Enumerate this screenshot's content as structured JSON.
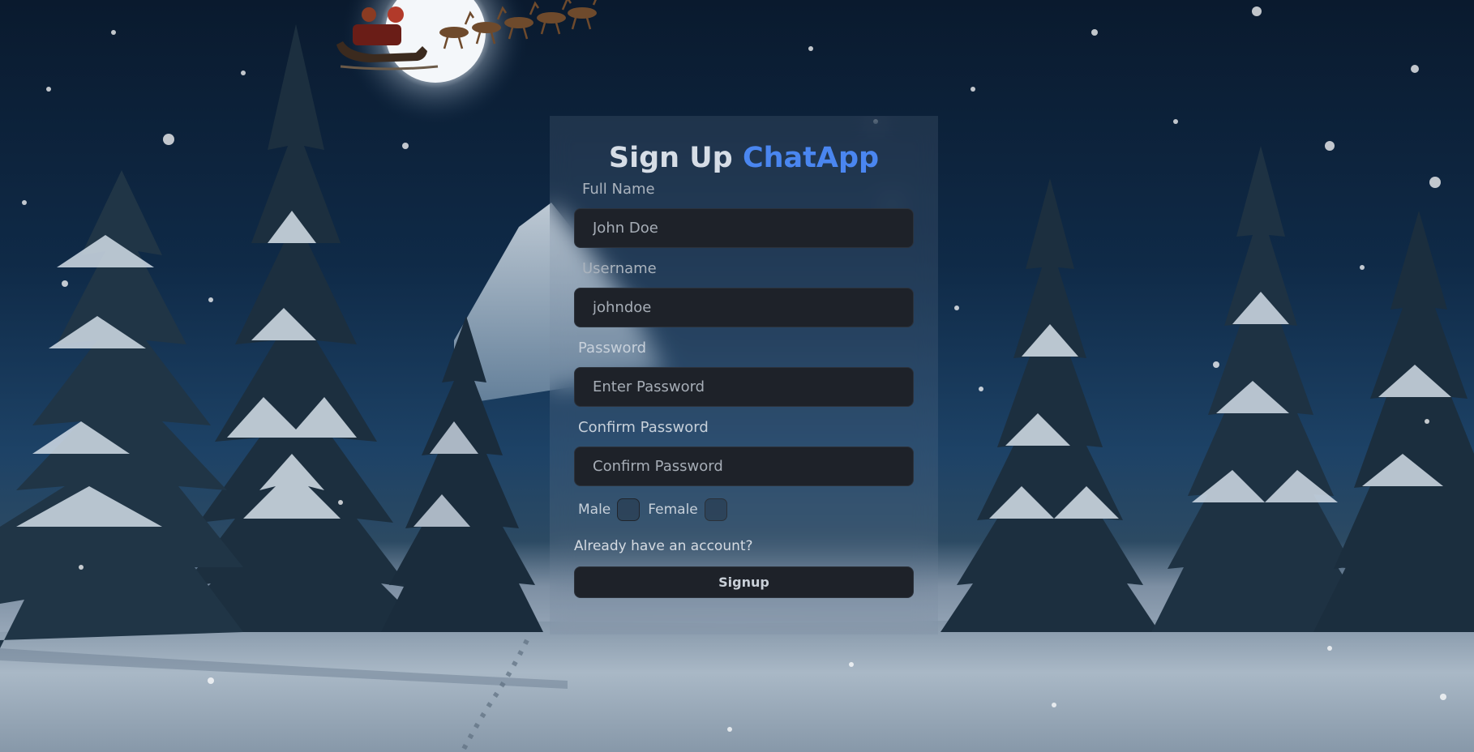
{
  "form": {
    "title": "Sign Up",
    "brand": "ChatApp",
    "full_name": {
      "label": "Full Name",
      "placeholder": "John Doe"
    },
    "username": {
      "label": "Username",
      "placeholder": "johndoe"
    },
    "password": {
      "label": "Password",
      "placeholder": "Enter Password"
    },
    "confirm_password": {
      "label": "Confirm Password",
      "placeholder": "Confirm Password"
    },
    "gender": {
      "male_label": "Male",
      "female_label": "Female"
    },
    "login_link": "Already have an account?",
    "submit_label": "Signup"
  },
  "colors": {
    "brand": "#4a86f0",
    "input_bg": "#1e2229",
    "title": "#d6dde6"
  },
  "background": {
    "icons": [
      "moon-icon",
      "santa-sleigh-icon",
      "snow-tree-icon",
      "snowflake-icon"
    ]
  }
}
